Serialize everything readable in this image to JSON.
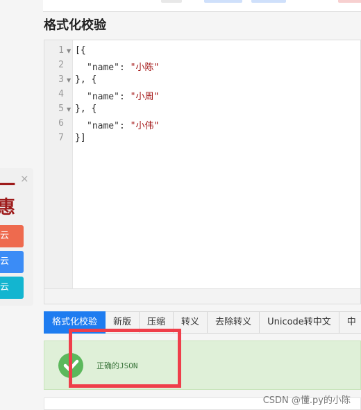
{
  "page_title": "格式化校验",
  "editor": {
    "line_numbers": [
      "1",
      "2",
      "3",
      "4",
      "5",
      "6",
      "7"
    ],
    "lines": {
      "l1": "[{",
      "l2_key": "\"name\"",
      "l2_sep": ": ",
      "l2_val": "\"小陈\"",
      "l3": "}, {",
      "l4_key": "\"name\"",
      "l4_sep": ": ",
      "l4_val": "\"小周\"",
      "l5": "}, {",
      "l6_key": "\"name\"",
      "l6_sep": ": ",
      "l6_val": "\"小伟\"",
      "l7": "}]"
    },
    "fold_icon": "caret-down-icon"
  },
  "toolbar": {
    "buttons": [
      {
        "label": "格式化校验",
        "active": true
      },
      {
        "label": "新版"
      },
      {
        "label": "压缩"
      },
      {
        "label": "转义"
      },
      {
        "label": "去除转义"
      },
      {
        "label": "Unicode转中文"
      },
      {
        "label": "中"
      }
    ]
  },
  "result": {
    "icon": "check-circle-icon",
    "text": "正确的JSON"
  },
  "ad": {
    "close_symbol": "×",
    "title_top": "一",
    "title_bottom": "惠",
    "buttons": [
      {
        "label": "云",
        "color": "#ee6a4e"
      },
      {
        "label": "云",
        "color": "#3b8cf6"
      },
      {
        "label": "云",
        "color": "#13b5d0"
      }
    ]
  },
  "watermark": "CSDN @懂.py的小陈",
  "colors": {
    "accent": "#1e7cf0",
    "success_bg": "#dff0d8",
    "success_icon": "#5cb85c",
    "highlight": "#ef3e4a"
  }
}
